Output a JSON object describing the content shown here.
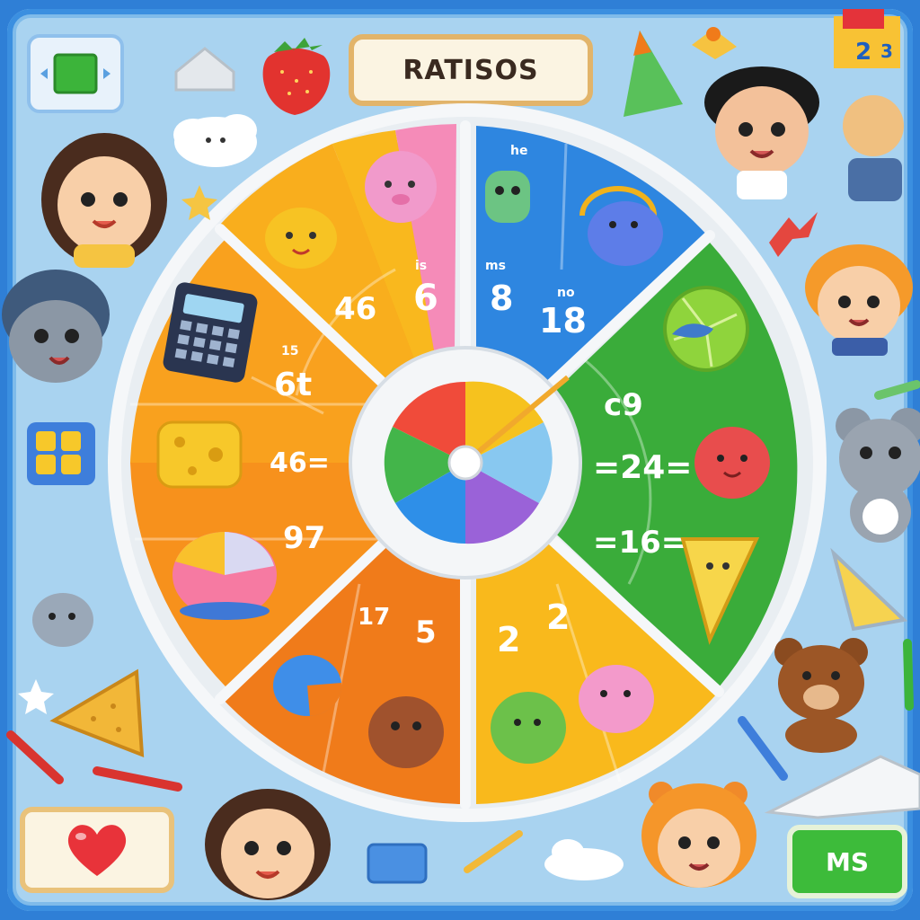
{
  "title": "RATISOS",
  "buttons": {
    "bottom_right_label": "MS"
  },
  "wheel": {
    "segments": [
      {
        "id": "orange-left-top",
        "labels": [
          "6t"
        ],
        "color": "#f89a1c"
      },
      {
        "id": "orange-left-mid",
        "labels": [
          "46="
        ],
        "color": "#f7931e"
      },
      {
        "id": "orange-left-low",
        "labels": [
          "97"
        ],
        "color": "#f48a1d"
      },
      {
        "id": "orange-top",
        "labels": [
          "46"
        ],
        "color": "#f9b21c"
      },
      {
        "id": "pink-top",
        "labels": [
          "6"
        ],
        "color": "#f58bb8"
      },
      {
        "id": "blue-top",
        "labels": [
          "8",
          "18"
        ],
        "color": "#2e86e0"
      },
      {
        "id": "green-right",
        "labels": [
          "c9",
          "=24=",
          "=16="
        ],
        "color": "#3aac3a"
      },
      {
        "id": "yellow-bottom",
        "labels": [
          "2",
          "2"
        ],
        "color": "#f9b91c"
      },
      {
        "id": "orange-bottom",
        "labels": [
          "17",
          "5"
        ],
        "color": "#f07b1a"
      }
    ],
    "small_captions": {
      "blue_a": "ms",
      "blue_b": "no",
      "pink_a": "is",
      "blue_top": "he",
      "orange_a": "15"
    }
  },
  "icons": [
    "calculator-icon",
    "strawberry-icon",
    "cheese-icon",
    "heart-icon",
    "triangle-ruler-icon",
    "pencil-icon",
    "star-icon",
    "cloud-icon",
    "bear-icon",
    "cube-icon"
  ]
}
